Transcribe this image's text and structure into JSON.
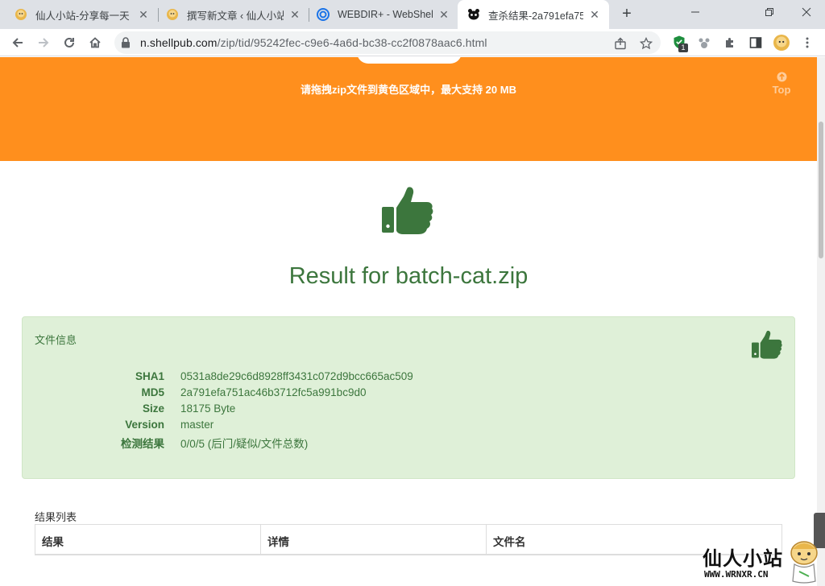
{
  "browser": {
    "tabs": [
      {
        "title": "仙人小站-分享每一天",
        "favicon": "mascot-icon",
        "active": false
      },
      {
        "title": "撰写新文章 ‹ 仙人小站",
        "favicon": "mascot-icon",
        "active": false
      },
      {
        "title": "WEBDIR+ - WebShell",
        "favicon": "webdir-icon",
        "active": false
      },
      {
        "title": "查杀结果-2a791efa75",
        "favicon": "panda-icon",
        "active": true
      }
    ],
    "new_tab_label": "+",
    "url_host": "n.shellpub.com",
    "url_path": "/zip/tid/95242fec-c9e6-4a6d-bc38-cc2f0878aac6.html",
    "extension_badge": "1"
  },
  "banner": {
    "hint": "请拖拽zip文件到黄色区域中，最大支持 20 MB",
    "color": "#ff8f1d",
    "top_label": "Top"
  },
  "result": {
    "title": "Result for batch-cat.zip",
    "status_icon": "thumbs-up-icon",
    "color": "#3c763d"
  },
  "file_info": {
    "heading": "文件信息",
    "rows": [
      {
        "key": "SHA1",
        "value": "0531a8de29c6d8928ff3431c072d9bcc665ac509"
      },
      {
        "key": "MD5",
        "value": "2a791efa751ac46b3712fc5a991bc9d0"
      },
      {
        "key": "Size",
        "value": "18175 Byte"
      },
      {
        "key": "Version",
        "value": "master"
      },
      {
        "key": "检测结果",
        "value": "0/0/5 (后门/疑似/文件总数)"
      }
    ]
  },
  "results_list": {
    "label": "结果列表",
    "columns": [
      "结果",
      "详情",
      "文件名"
    ]
  },
  "watermark": {
    "title": "仙人小站",
    "domain": "WWW.WRNXR.CN"
  }
}
